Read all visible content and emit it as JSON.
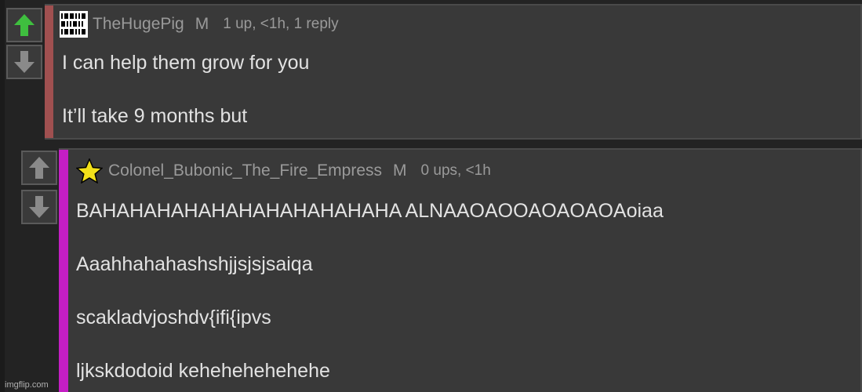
{
  "comments": [
    {
      "username": "TheHugePig",
      "badge": "M",
      "stats": "1 up, <1h, 1 reply",
      "avatar_icon": "binary-pattern-avatar-icon",
      "bar_color": "#a05050",
      "upvoted": true,
      "paragraphs": [
        "I can help them grow for you",
        "It’ll take 9 months but"
      ]
    },
    {
      "username": "Colonel_Bubonic_The_Fire_Empress",
      "badge": "M",
      "stats": "0 ups, <1h",
      "avatar_icon": "yellow-star-avatar-icon",
      "bar_color": "#c41ec4",
      "upvoted": false,
      "paragraphs": [
        "BAHAHAHAHAHAHAHAHAHAHAHA ALNAAOAOOAOAOAOAoiaa",
        "Aaahhahahashshjjsjsjsaiqa",
        "scakladvjoshdv{ifi{ipvs",
        "ljkskdodoid kehehehehehehe"
      ]
    }
  ],
  "colors": {
    "upvote_active": "#3fbf3f",
    "vote_inactive": "#8a8a8a"
  },
  "watermark": "imgflip.com"
}
